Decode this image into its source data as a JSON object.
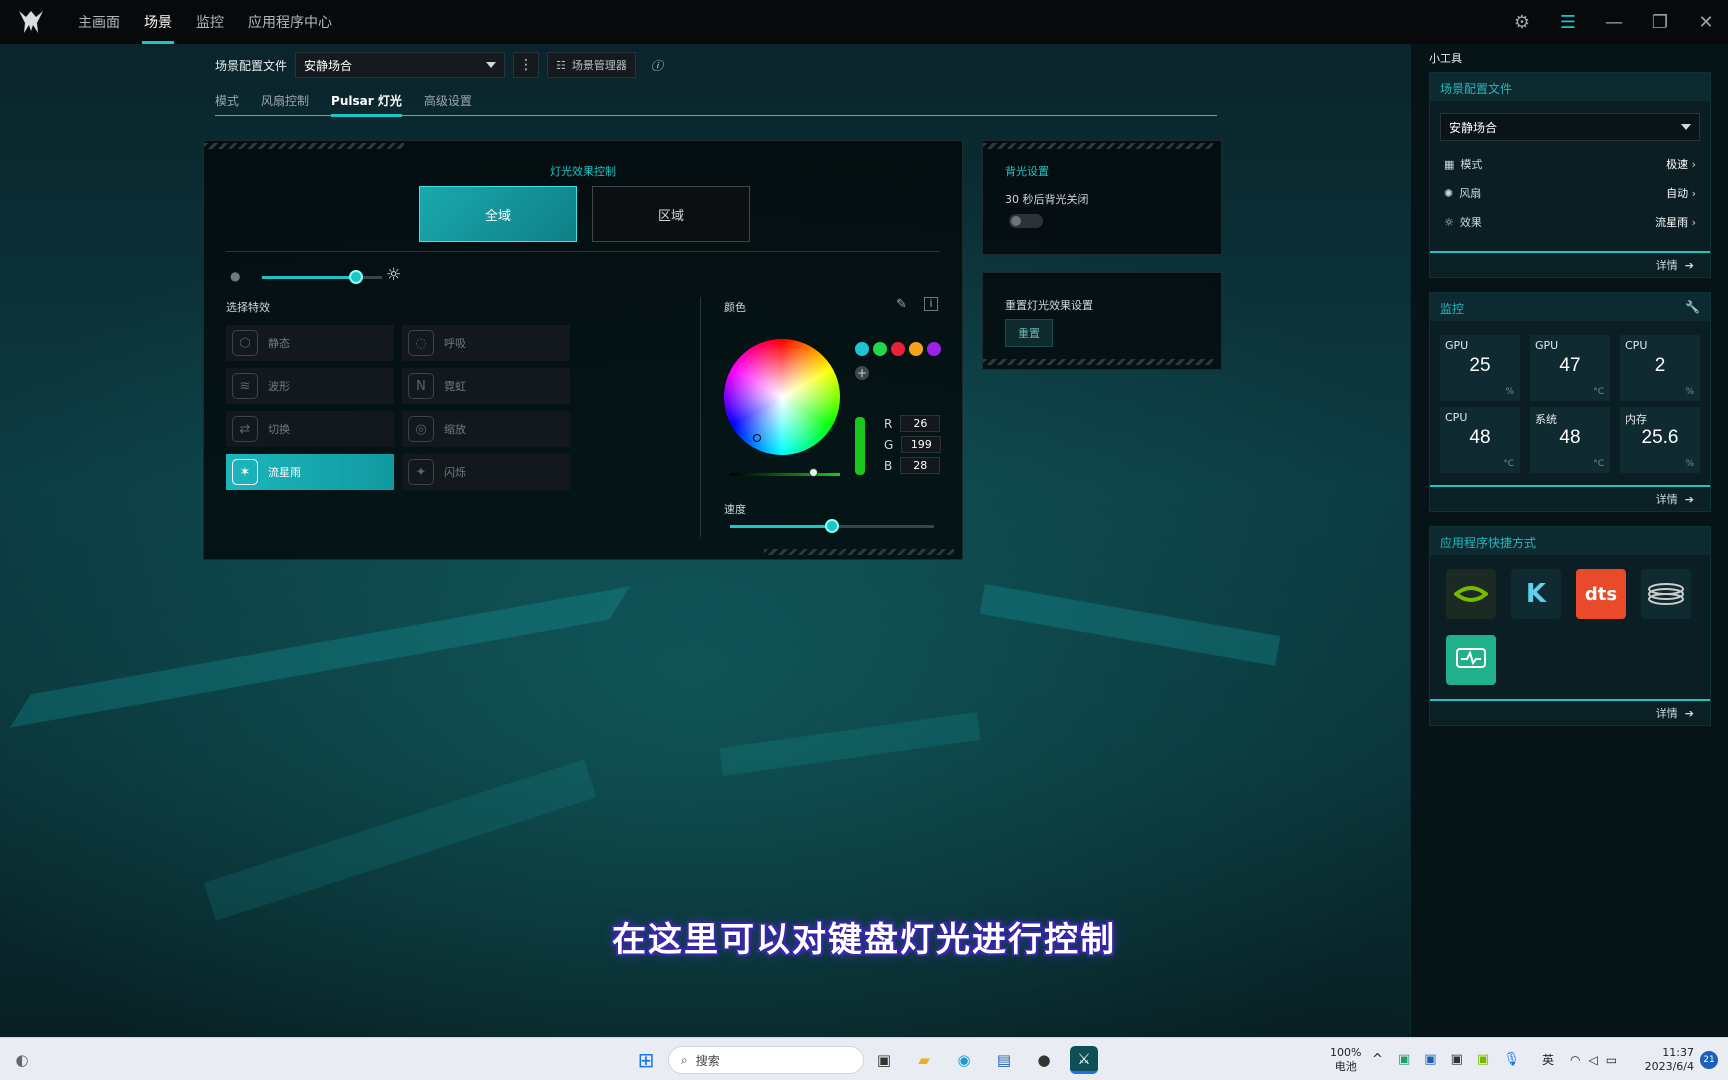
{
  "nav": {
    "tabs": [
      "主画面",
      "场景",
      "监控",
      "应用程序中心"
    ],
    "active": 1
  },
  "profile": {
    "label": "场景配置文件",
    "selected": "安静场合",
    "manager_label": "场景管理器"
  },
  "subtabs": [
    "模式",
    "风扇控制",
    "Pulsar 灯光",
    "高级设置"
  ],
  "lighting": {
    "title": "灯光效果控制",
    "global_label": "全域",
    "zone_label": "区域",
    "brightness_fraction": 0.78,
    "effects_title": "选择特效",
    "effects": [
      {
        "label": "静态",
        "icon": "cube-icon"
      },
      {
        "label": "呼吸",
        "icon": "breath-icon"
      },
      {
        "label": "波形",
        "icon": "wave-icon"
      },
      {
        "label": "霓虹",
        "icon": "neon-icon"
      },
      {
        "label": "切换",
        "icon": "switch-icon"
      },
      {
        "label": "缩放",
        "icon": "zoom-icon"
      },
      {
        "label": "流星雨",
        "icon": "meteor-icon"
      },
      {
        "label": "闪烁",
        "icon": "sparkle-icon"
      }
    ],
    "active_effect": "流星雨",
    "color_title": "颜色",
    "preset_colors": [
      "#1ec3d6",
      "#22d64a",
      "#e8213a",
      "#f2a41a",
      "#9b22e8"
    ],
    "rgb": {
      "r": "26",
      "g": "199",
      "b": "28"
    },
    "speed_label": "速度",
    "speed_fraction": 0.5
  },
  "backlight": {
    "title": "背光设置",
    "text": "30 秒后背光关闭",
    "enabled": false
  },
  "reset": {
    "title": "重置灯光效果设置",
    "button": "重置"
  },
  "sidebar": {
    "title": "小工具",
    "profile_card": {
      "header": "场景配置文件",
      "selected": "安静场合",
      "rows": [
        {
          "label": "模式",
          "value": "极速",
          "icon": "grid-icon"
        },
        {
          "label": "风扇",
          "value": "自动",
          "icon": "fan-icon"
        },
        {
          "label": "效果",
          "value": "流星雨",
          "icon": "sun-icon"
        }
      ],
      "footer": "详情"
    },
    "monitor_card": {
      "header": "监控",
      "tiles": [
        {
          "title": "GPU",
          "value": "25",
          "unit": "%"
        },
        {
          "title": "GPU",
          "value": "47",
          "unit": "°C"
        },
        {
          "title": "CPU",
          "value": "2",
          "unit": "%"
        },
        {
          "title": "CPU",
          "value": "48",
          "unit": "°C"
        },
        {
          "title": "系统",
          "value": "48",
          "unit": "°C"
        },
        {
          "title": "内存",
          "value": "25.6",
          "unit": "%"
        }
      ],
      "footer": "详情"
    },
    "apps_card": {
      "header": "应用程序快捷方式",
      "apps": [
        {
          "name": "nvidia-icon",
          "label": "",
          "bg": "#1b2a22",
          "fg": "#76b900"
        },
        {
          "name": "killer-icon",
          "label": "K",
          "bg": "#0f2b31",
          "fg": "#5fd0f0"
        },
        {
          "name": "dts-icon",
          "label": "dts",
          "bg": "#e84a2a",
          "fg": "#ffffff"
        },
        {
          "name": "coil-icon",
          "label": "",
          "bg": "#0f2b31",
          "fg": "#c8c8c8"
        },
        {
          "name": "monitor-app-icon",
          "label": "",
          "bg": "#20b08a",
          "fg": "#ffffff"
        }
      ],
      "footer": "详情"
    }
  },
  "subtitle": "在这里可以对键盘灯光进行控制",
  "taskbar": {
    "search": "搜索",
    "battery_pct": "100%",
    "battery_label": "电池",
    "ime": "英",
    "time": "11:37",
    "date": "2023/6/4",
    "badge": "21"
  }
}
